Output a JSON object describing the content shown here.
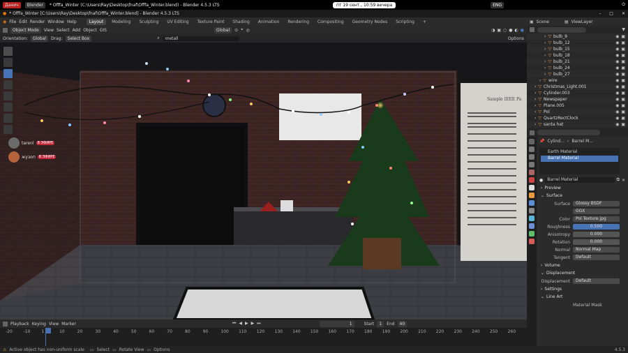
{
  "os_topbar": {
    "left_app": "Данич",
    "left_app2": "Blender",
    "tab_title": "* Offfa_Winter (C:\\Users\\Ray\\Desktop\\fnaf\\Offfa_Winter.blend) - Blender 4.5.3 LTS",
    "clock": "пт 19 сент., 10:59 вечера",
    "lang": "ENG"
  },
  "window_title": "* Offfa_Winter [C:\\Users\\Ray\\Desktop\\fnaf\\Offfa_Winter.blend] - Blender 4.5.3 LTS",
  "menu": {
    "items": [
      "File",
      "Edit",
      "Render",
      "Window",
      "Help"
    ],
    "workspaces": [
      "Layout",
      "Modeling",
      "Sculpting",
      "UV Editing",
      "Texture Paint",
      "Shading",
      "Animation",
      "Rendering",
      "Compositing",
      "Geometry Nodes",
      "Scripting"
    ],
    "active_workspace": "Layout",
    "scene": "Scene",
    "view_layer": "ViewLayer"
  },
  "viewport_header": {
    "mode": "Object Mode",
    "menus": [
      "View",
      "Select",
      "Add",
      "Object",
      "GIS"
    ],
    "orientation_label": "Orientation:",
    "orientation": "Global",
    "drag_label": "Drag:",
    "drag": "Select Box",
    "transform": "Global",
    "options": "Options",
    "search": "metall"
  },
  "chat": [
    {
      "name": "tarenl",
      "badge": "В ЭФИРЕ"
    },
    {
      "name": "жузоп",
      "badge": "В ЭФИРЕ"
    }
  ],
  "scene_text": {
    "paper_title": "Sample IEEE Pa"
  },
  "timeline": {
    "menus": [
      "Playback",
      "Keying",
      "View",
      "Marker"
    ],
    "current_frame": "1",
    "start_label": "Start",
    "start": "1",
    "end_label": "End",
    "end": "40",
    "ticks": [
      "-20",
      "-10",
      "1",
      "10",
      "20",
      "30",
      "40",
      "50",
      "60",
      "70",
      "80",
      "90",
      "100",
      "110",
      "120",
      "130",
      "140",
      "150",
      "160",
      "170",
      "180",
      "190",
      "200",
      "210",
      "220",
      "230",
      "240",
      "250",
      "260"
    ]
  },
  "status": {
    "warning": "Active object has non-uniform scale",
    "select": "Select",
    "rotate": "Rotate View",
    "options": "Options",
    "version": "4.5.3"
  },
  "outliner": {
    "rows": [
      {
        "label": "bulb_9",
        "indent": 3
      },
      {
        "label": "bulb_12",
        "indent": 3
      },
      {
        "label": "bulb_15",
        "indent": 3
      },
      {
        "label": "bulb_18",
        "indent": 3
      },
      {
        "label": "bulb_21",
        "indent": 3
      },
      {
        "label": "bulb_24",
        "indent": 3
      },
      {
        "label": "bulb_27",
        "indent": 3
      },
      {
        "label": "wire",
        "indent": 2
      },
      {
        "label": "Christmas_Light.001",
        "indent": 1
      },
      {
        "label": "Cylinder.003",
        "indent": 1
      },
      {
        "label": "Newspaper",
        "indent": 1
      },
      {
        "label": "Plane.005",
        "indent": 1
      },
      {
        "label": "Pol",
        "indent": 1
      },
      {
        "label": "QuartzRectClock",
        "indent": 1
      },
      {
        "label": "santa hat",
        "indent": 1
      }
    ]
  },
  "properties": {
    "breadcrumb": [
      "Cylind...",
      "Barrel M..."
    ],
    "slots": [
      "Earth Material",
      "Barrel Material"
    ],
    "material": "Barrel Material",
    "preview": "Preview",
    "surface_panel": "Surface",
    "surface_label": "Surface",
    "surface": "Glossy BSDF",
    "distribution": "GGX",
    "color_label": "Color",
    "color": "Pol Texture.jpg",
    "roughness_label": "Roughness",
    "roughness": "0.500",
    "anisotropy_label": "Anisotropy",
    "anisotropy": "0.000",
    "rotation_label": "Rotation",
    "rotation": "0.000",
    "normal_label": "Normal",
    "normal": "Normal Map",
    "tangent_label": "Tangent",
    "tangent": "Default",
    "volume": "Volume",
    "displacement_panel": "Displacement",
    "displacement_label": "Displacement",
    "displacement": "Default",
    "settings": "Settings",
    "lineart": "Line Art",
    "material_mask": "Material Mask"
  }
}
